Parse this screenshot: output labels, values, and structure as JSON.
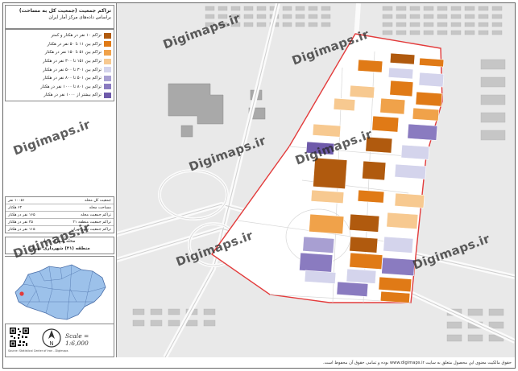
{
  "title": {
    "line1": "تراکم جمعیت (جمعیت کل به مساحت)",
    "line2": "براساس داده‌های مرکز آمار ایران"
  },
  "legend": [
    {
      "label": "تراکم ۱۰ نفر در هکتار و کمتر",
      "color": "#b05a0e"
    },
    {
      "label": "تراکم بین ۱۱ تا ۵۰ نفر در هکتار",
      "color": "#e07a16"
    },
    {
      "label": "تراکم بین ۵۱ تا ۱۵۰ نفر در هکتار",
      "color": "#f0a24a"
    },
    {
      "label": "تراکم بین ۱۵۱ تا ۳۰۰ نفر در هکتار",
      "color": "#f7c990"
    },
    {
      "label": "تراکم بین ۳۰۱ تا ۵۰۰ نفر در هکتار",
      "color": "#d4d4ec"
    },
    {
      "label": "تراکم بین ۵۰۱ تا ۸۰۰ نفر در هکتار",
      "color": "#a89fd2"
    },
    {
      "label": "تراکم بین ۸۰۱ تا ۱۰۰۰ نفر در هکتار",
      "color": "#8a7bc0"
    },
    {
      "label": "تراکم بیشتر از ۱۰۰۰ نفر در هکتار",
      "color": "#6e5aaa"
    }
  ],
  "stats": [
    {
      "label": "جمعیت کل محله",
      "value": "۱۰۰۵۱ نفر"
    },
    {
      "label": "مساحت محله",
      "value": "۶۲ هکتار"
    },
    {
      "label": "تراکم جمعیت محله",
      "value": "۱۶۵ نفر در هکتار"
    },
    {
      "label": "تراکم جمعیت منطقه ۲۱",
      "value": "۴۵ نفر در هکتار"
    },
    {
      "label": "تراکم جمعیت شهر تهران",
      "value": "۱۱۵ نفر در هکتار"
    }
  ],
  "region": {
    "line1": "محله شهرک دریا",
    "line2": "منطقه (۲۱) شهرداری تهران"
  },
  "scale": "Scale = 1:6,000",
  "credit": "Source: Statistical Center of Iran - Digimaps",
  "watermark": "Digimaps.ir",
  "footer": "حقوق مالکیت معنوی این محصول متعلق به سایت www.digimaps.ir بوده و تمامی حقوق آن محفوظ است.",
  "colors": {
    "map_bg": "#e9e9e9",
    "boundary": "#e33b3b",
    "parcel_inside": "#ffffff",
    "building": "#c4c4c4"
  }
}
